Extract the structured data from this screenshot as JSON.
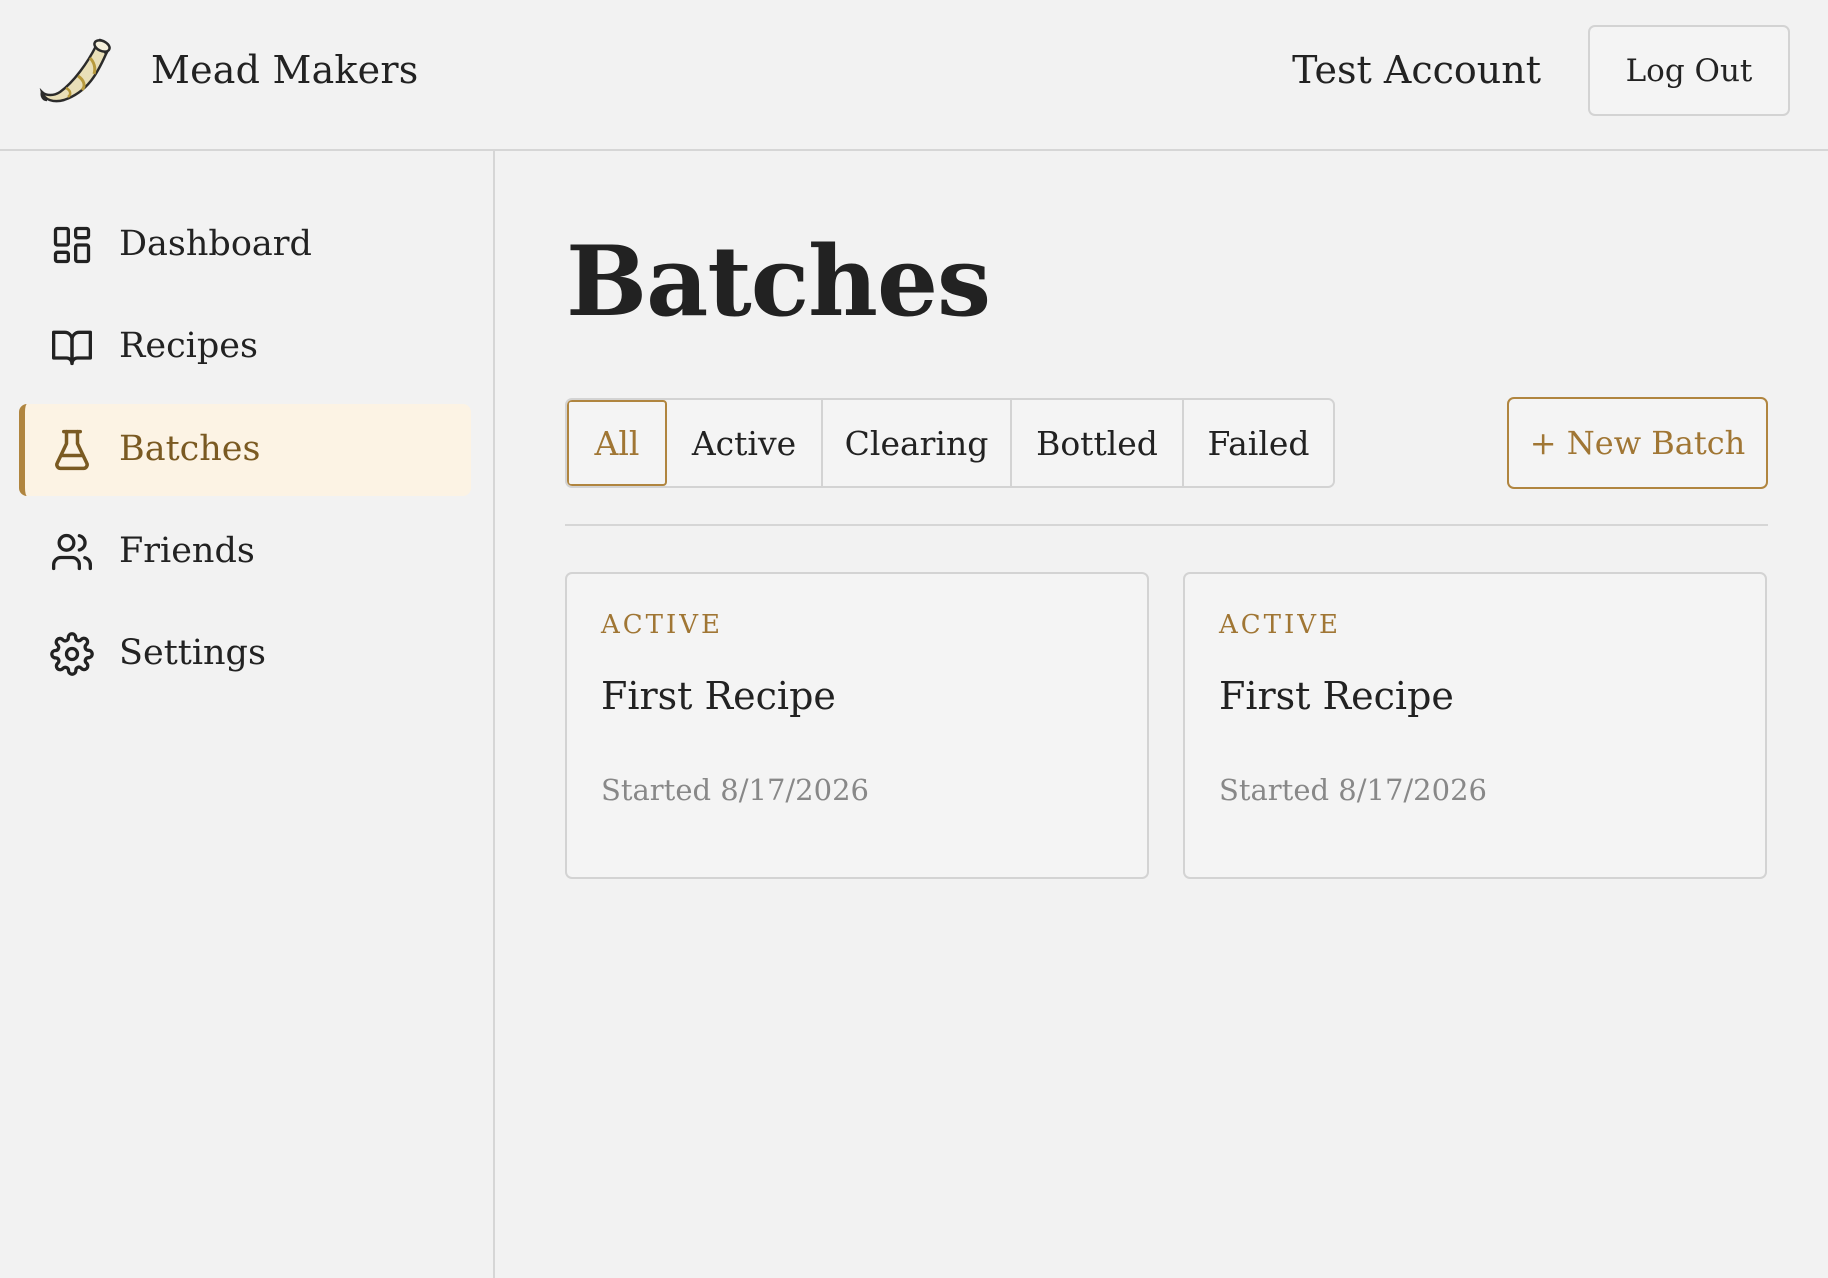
{
  "header": {
    "app_title": "Mead Makers",
    "account_name": "Test Account",
    "logout_label": "Log Out",
    "logo_icon": "drinking-horn-icon"
  },
  "sidebar": {
    "items": [
      {
        "label": "Dashboard",
        "icon": "dashboard-grid-icon",
        "active": false
      },
      {
        "label": "Recipes",
        "icon": "open-book-icon",
        "active": false
      },
      {
        "label": "Batches",
        "icon": "flask-icon",
        "active": true
      },
      {
        "label": "Friends",
        "icon": "users-icon",
        "active": false
      },
      {
        "label": "Settings",
        "icon": "gear-icon",
        "active": false
      }
    ]
  },
  "main": {
    "title": "Batches",
    "filters": [
      {
        "label": "All",
        "selected": true
      },
      {
        "label": "Active",
        "selected": false
      },
      {
        "label": "Clearing",
        "selected": false
      },
      {
        "label": "Bottled",
        "selected": false
      },
      {
        "label": "Failed",
        "selected": false
      }
    ],
    "new_batch_label": "+ New Batch",
    "batches": [
      {
        "status": "ACTIVE",
        "recipe": "First Recipe",
        "started": "Started 8/17/2026"
      },
      {
        "status": "ACTIVE",
        "recipe": "First Recipe",
        "started": "Started 8/17/2026"
      }
    ]
  },
  "colors": {
    "accent": "#b0853f",
    "accent_text": "#a07634",
    "active_nav_bg": "#fcf3e4",
    "background": "#f2f2f2",
    "border": "#d3d3d3"
  }
}
